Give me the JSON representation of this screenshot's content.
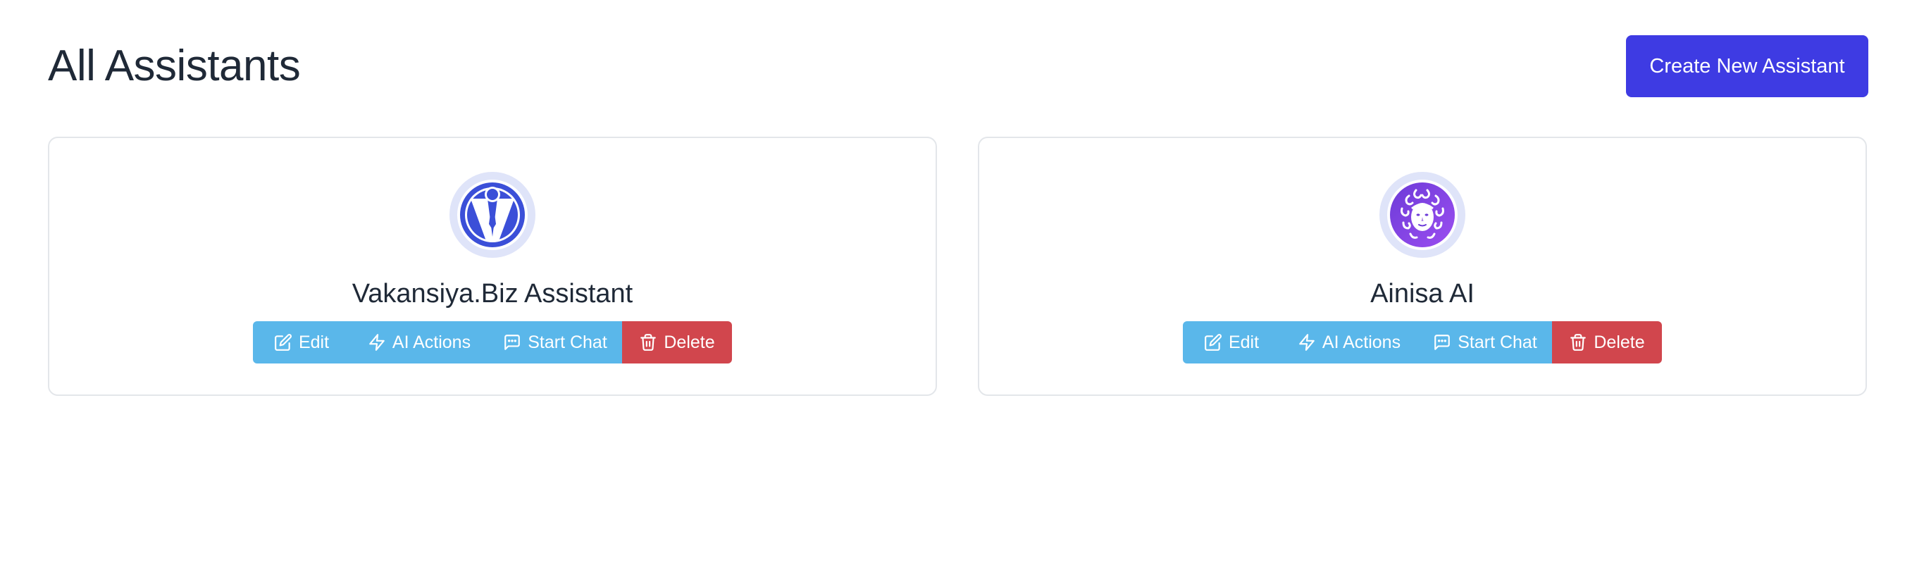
{
  "header": {
    "title": "All Assistants",
    "create_label": "Create New Assistant"
  },
  "colors": {
    "primary": "#3e3be3",
    "info": "#5ab7ea",
    "danger": "#d1464d",
    "text": "#1f2937"
  },
  "assistants": [
    {
      "name": "Vakansiya.Biz Assistant",
      "avatar_icon": "businessman-tie-logo-icon",
      "actions": {
        "edit": "Edit",
        "ai_actions": "AI Actions",
        "start_chat": "Start Chat",
        "delete": "Delete"
      }
    },
    {
      "name": "Ainisa AI",
      "avatar_icon": "medusa-face-logo-icon",
      "actions": {
        "edit": "Edit",
        "ai_actions": "AI Actions",
        "start_chat": "Start Chat",
        "delete": "Delete"
      }
    }
  ],
  "icons": {
    "edit": "pencil-square-icon",
    "ai_actions": "lightning-bolt-icon",
    "start_chat": "chat-bubble-icon",
    "delete": "trash-icon"
  }
}
